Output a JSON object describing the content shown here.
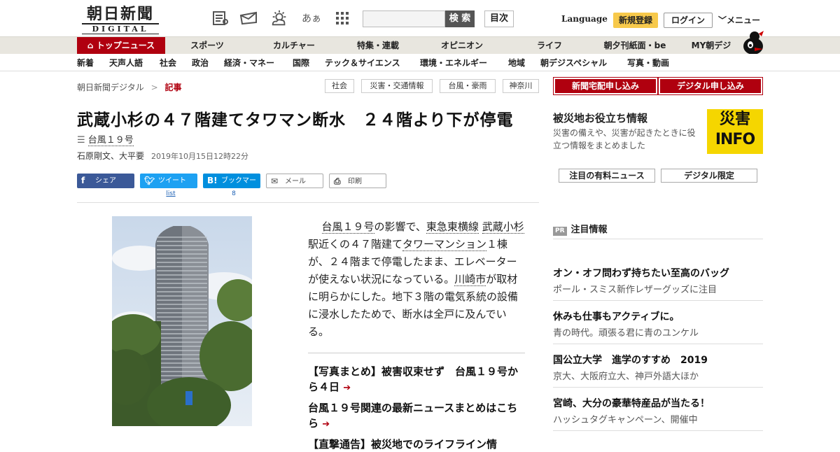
{
  "header": {
    "logo_main": "朝日新聞",
    "logo_sub": "DIGITAL",
    "search_button": "検 索",
    "toc_button": "目次",
    "language": "Language",
    "register": "新規登録",
    "login": "ログイン",
    "menu": "メニュー",
    "icons": [
      "newspaper-icon",
      "mail-icon",
      "weather-icon",
      "font-size-icon",
      "grid-icon"
    ],
    "font_size_glyph": "あぁ"
  },
  "nav_primary": [
    "トップニュース",
    "スポーツ",
    "カルチャー",
    "特集・連載",
    "オピニオン",
    "ライフ",
    "朝夕刊紙面・be",
    "MY朝デジ"
  ],
  "nav_secondary": [
    "新着",
    "天声人語",
    "社会",
    "政治",
    "経済・マネー",
    "国際",
    "テック＆サイエンス",
    "環境・エネルギー",
    "地域",
    "朝デジスペシャル",
    "写真・動画"
  ],
  "breadcrumb": {
    "site": "朝日新聞デジタル",
    "sep": ">",
    "current": "記事"
  },
  "tags": [
    "社会",
    "災害・交通情報",
    "台風・豪雨",
    "神奈川"
  ],
  "article": {
    "title": "武蔵小杉の４７階建てタワマン断水　２４階より下が停電",
    "series": "台風１９号",
    "authors": "石原剛文、大平要",
    "date": "2019年10月15日12時22分",
    "share": {
      "facebook": "シェア",
      "twitter": "ツイート",
      "twitter_count": "list",
      "hatena": "ブックマーク",
      "hatena_count": "8",
      "mail": "メール",
      "print": "印刷"
    },
    "body": {
      "p1": "台風１９号",
      "p2": "の影響で、",
      "p3": "東急東横線",
      "p4": "武蔵小杉",
      "p5": "駅近くの４７階建て",
      "p6": "タワーマンション",
      "p7": "１棟が、２４階まで停電したまま、エレベーターが使えない状況になっている。",
      "p8": "川崎市",
      "p9": "が取材に明らかにした。地下３階の電気系統の設備に浸水したためで、断水は全戸に及んでいる。"
    },
    "links": [
      "【写真まとめ】被害収束せず　台風１９号から４日",
      "台風１９号関連の最新ニュースまとめはこちら",
      "【直撃通告】被災地でのライフライン情"
    ]
  },
  "sidebar": {
    "delivery": "新聞宅配申し込み",
    "digital": "デジタル申し込み",
    "disaster_heading": "被災地お役立ち情報",
    "disaster_text": "災害の備えや、災害が起きたときに役立つ情報をまとめました",
    "info_top": "災害",
    "info_bottom": "INFO",
    "paid_news": "注目の有料ニュース",
    "digital_only": "デジタル限定",
    "pr_badge": "PR",
    "pr_heading": "注目情報",
    "pr_items": [
      {
        "title": "オン・オフ問わず持ちたい至高のバッグ",
        "sub": "ポール・スミス新作レザーグッズに注目"
      },
      {
        "title": "休みも仕事もアクティブに。",
        "sub": "青の時代。頑張る君に青のユンケル"
      },
      {
        "title": "国公立大学　進学のすすめ　2019",
        "sub": "京大、大阪府立大、神戸外語大ほか"
      },
      {
        "title": "宮崎、大分の豪華特産品が当たる！",
        "sub": "ハッシュタグキャンペーン、開催中"
      }
    ]
  },
  "colors": {
    "brand_red": "#b0000f",
    "register_yellow": "#f7c94b",
    "info_yellow": "#f5d600"
  }
}
